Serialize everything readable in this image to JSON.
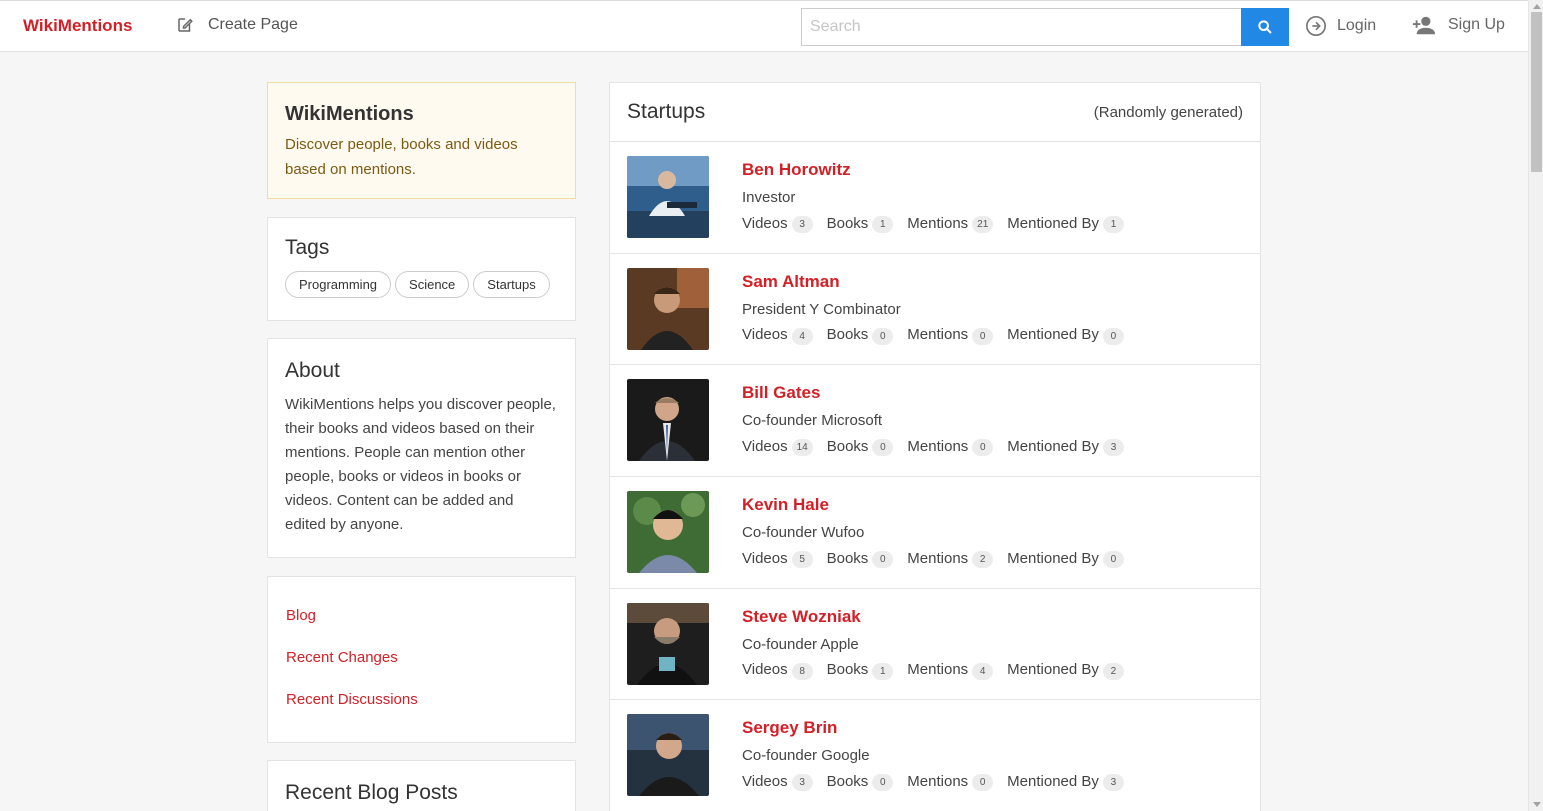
{
  "nav": {
    "brand": "WikiMentions",
    "create_page": "Create Page",
    "search_placeholder": "Search",
    "login": "Login",
    "signup": "Sign Up"
  },
  "intro": {
    "title": "WikiMentions",
    "text": "Discover people, books and videos based on mentions."
  },
  "tags": {
    "title": "Tags",
    "items": [
      "Programming",
      "Science",
      "Startups"
    ]
  },
  "about": {
    "title": "About",
    "text": "WikiMentions helps you discover people, their books and videos based on their mentions. People can mention other people, books or videos in books or videos. Content can be added and edited by anyone."
  },
  "links": [
    "Blog",
    "Recent Changes",
    "Recent Discussions"
  ],
  "recent_posts": {
    "title": "Recent Blog Posts"
  },
  "main": {
    "title": "Startups",
    "note": "(Randomly generated)",
    "stat_labels": {
      "videos": "Videos",
      "books": "Books",
      "mentions": "Mentions",
      "mentioned_by": "Mentioned By"
    },
    "people": [
      {
        "name": "Ben Horowitz",
        "role": "Investor",
        "videos": "3",
        "books": "1",
        "mentions": "21",
        "mentioned_by": "1"
      },
      {
        "name": "Sam Altman",
        "role": "President Y Combinator",
        "videos": "4",
        "books": "0",
        "mentions": "0",
        "mentioned_by": "0"
      },
      {
        "name": "Bill Gates",
        "role": "Co-founder Microsoft",
        "videos": "14",
        "books": "0",
        "mentions": "0",
        "mentioned_by": "3"
      },
      {
        "name": "Kevin Hale",
        "role": "Co-founder Wufoo",
        "videos": "5",
        "books": "0",
        "mentions": "2",
        "mentioned_by": "0"
      },
      {
        "name": "Steve Wozniak",
        "role": "Co-founder Apple",
        "videos": "8",
        "books": "1",
        "mentions": "4",
        "mentioned_by": "2"
      },
      {
        "name": "Sergey Brin",
        "role": "Co-founder Google",
        "videos": "3",
        "books": "0",
        "mentions": "0",
        "mentioned_by": "3"
      }
    ]
  },
  "colors": {
    "brand": "#d32027",
    "accent": "#2188e6"
  }
}
